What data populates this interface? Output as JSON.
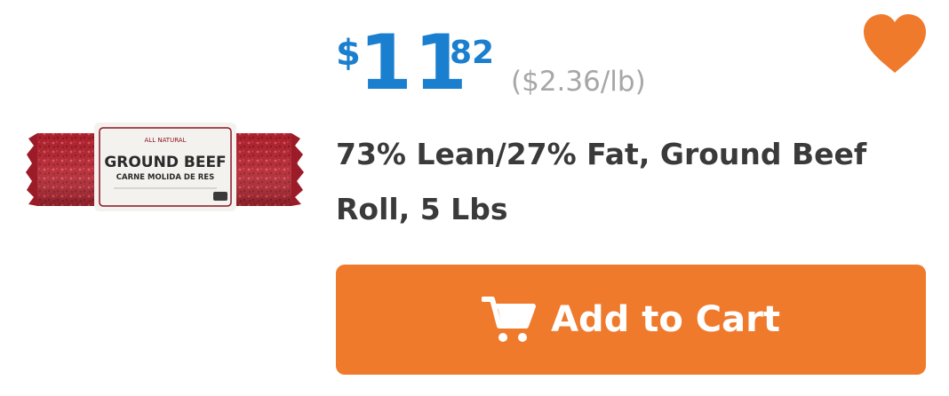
{
  "product": {
    "image_label": {
      "line1": "GROUND BEEF",
      "line2": "CARNE MOLIDA DE RES"
    },
    "price": {
      "currency": "$",
      "dollars": "11",
      "cents": "82",
      "unit_price": "($2.36/lb)"
    },
    "title": "73% Lean/27% Fat, Ground Beef Roll, 5 Lbs"
  },
  "actions": {
    "favorite_icon": "heart-icon",
    "add_to_cart_icon": "cart-icon",
    "add_to_cart_label": "Add to Cart"
  },
  "colors": {
    "price_blue": "#1b7fcf",
    "accent_orange": "#f07a2c",
    "title_text": "#3a3a3a",
    "unit_price_gray": "#a7a7a7"
  }
}
